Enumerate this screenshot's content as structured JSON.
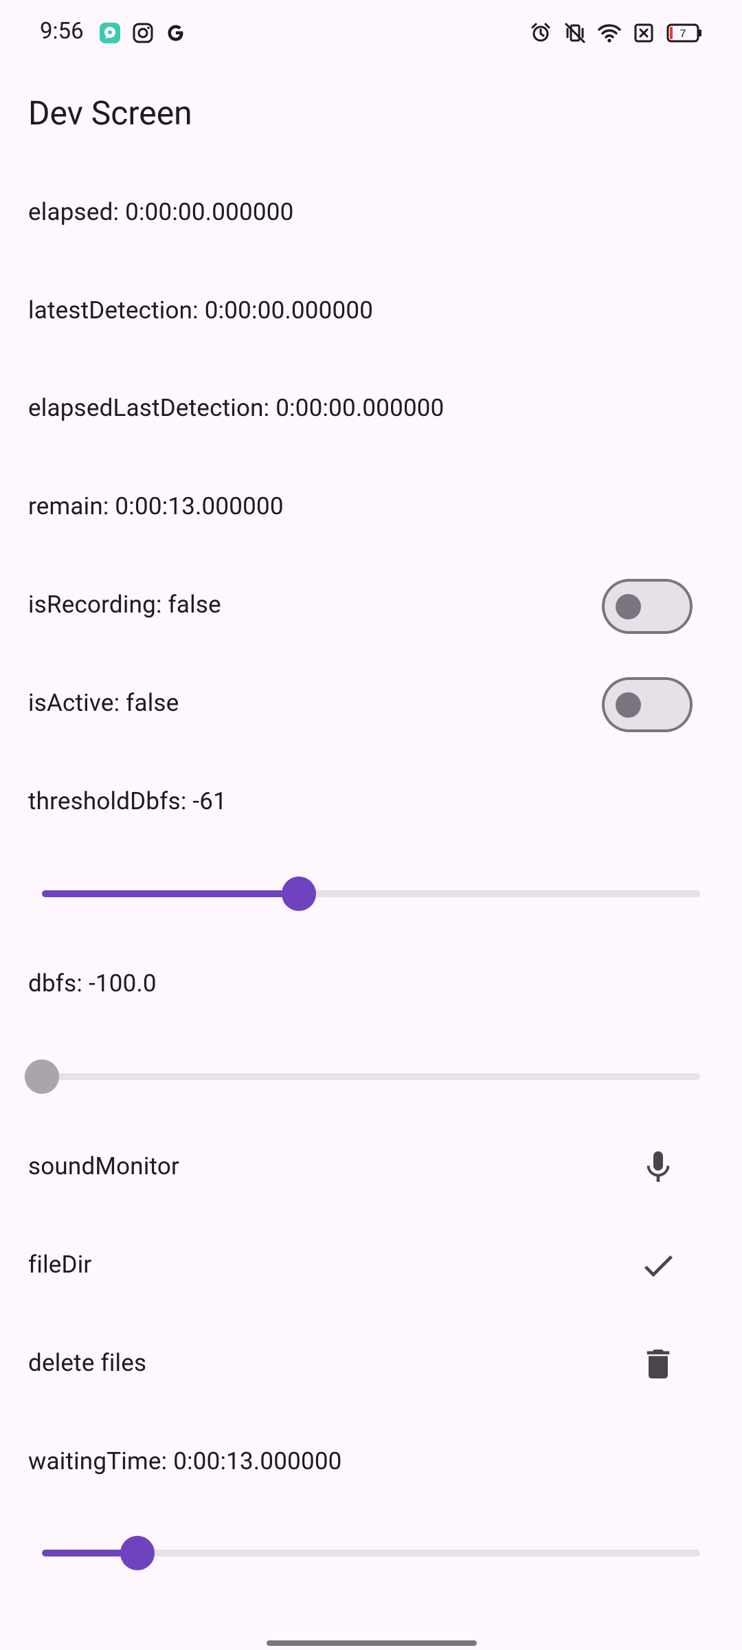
{
  "status_bar": {
    "time": "9:56",
    "left_icons": [
      "chat-app-icon",
      "instagram-icon",
      "google-icon"
    ],
    "right_icons": [
      "alarm-icon",
      "vibrate-off-icon",
      "wifi-icon",
      "sim-none-icon",
      "battery-icon"
    ],
    "battery_level": "7"
  },
  "app": {
    "title": "Dev Screen"
  },
  "rows": {
    "elapsed": "elapsed: 0:00:00.000000",
    "latest_detection": "latestDetection: 0:00:00.000000",
    "elapsed_last_detection": "elapsedLastDetection: 0:00:00.000000",
    "remain": "remain: 0:00:13.000000",
    "is_recording": {
      "label": "isRecording: false",
      "on": false
    },
    "is_active": {
      "label": "isActive: false",
      "on": false
    },
    "threshold": {
      "label": "thresholdDbfs: -61",
      "fraction": 0.39
    },
    "dbfs": {
      "label": "dbfs: -100.0",
      "fraction": 0.0,
      "enabled": false
    },
    "sound_monitor": {
      "label": "soundMonitor",
      "icon": "microphone-icon"
    },
    "file_dir": {
      "label": "fileDir",
      "icon": "check-icon"
    },
    "delete_files": {
      "label": "delete files",
      "icon": "trash-icon"
    },
    "waiting_time": {
      "label": "waitingTime: 0:00:13.000000",
      "fraction": 0.145
    }
  },
  "colors": {
    "background": "#fef7fd",
    "accent": "#6f43c0",
    "track_inactive": "#e6e0e9",
    "outline": "#79747e",
    "text": "#1d1b20",
    "icon": "#49454f"
  }
}
